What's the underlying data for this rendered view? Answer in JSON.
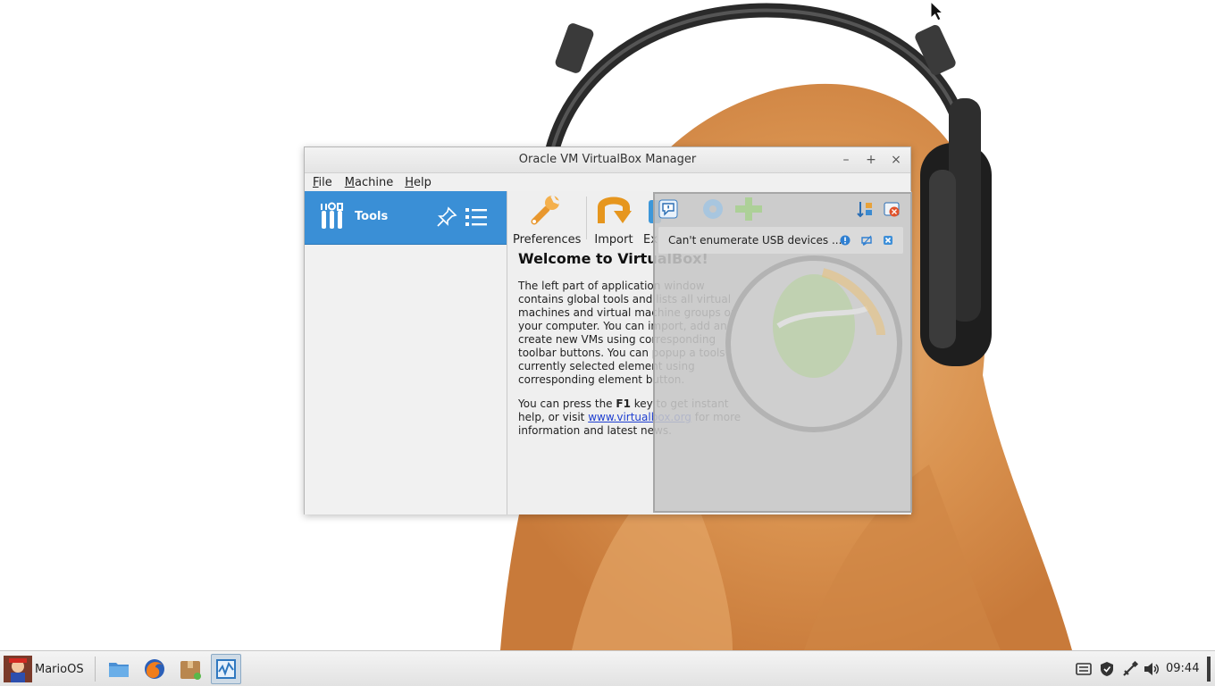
{
  "window": {
    "title": "Oracle VM VirtualBox Manager",
    "controls": {
      "minimize": "–",
      "maximize": "+",
      "close": "×"
    }
  },
  "menubar": {
    "items": [
      "File",
      "Machine",
      "Help"
    ]
  },
  "left_pane": {
    "tools_label": "Tools"
  },
  "toolbar": {
    "buttons": [
      {
        "label": "Preferences",
        "icon": "wrench-icon"
      },
      {
        "label": "Import",
        "icon": "import-arrow-icon"
      },
      {
        "label": "Ex",
        "icon": "export-icon"
      }
    ]
  },
  "welcome": {
    "title": "Welcome to VirtualBox!",
    "para1": "The left part of application window contains global tools and lists all virtual machines and virtual machine groups on your computer. You can import, add and create new VMs using corresponding toolbar buttons. You can popup a tools of currently selected element using corresponding element button.",
    "para2_prefix": "You can press the ",
    "para2_key": "F1",
    "para2_middle": " key to get instant help, or visit ",
    "para2_link": "www.virtualbox.org",
    "para2_suffix": " for more information and latest news."
  },
  "notification": {
    "text": "Can't enumerate USB devices ..."
  },
  "taskbar": {
    "start_label": "MarioOS",
    "clock": "09:44",
    "apps": [
      "file-manager-icon",
      "firefox-icon",
      "package-manager-icon",
      "virtualbox-task-icon"
    ]
  },
  "colors": {
    "selection_blue": "#3a8fd6",
    "link_blue": "#1f3fd0",
    "window_bg": "#efefef"
  }
}
